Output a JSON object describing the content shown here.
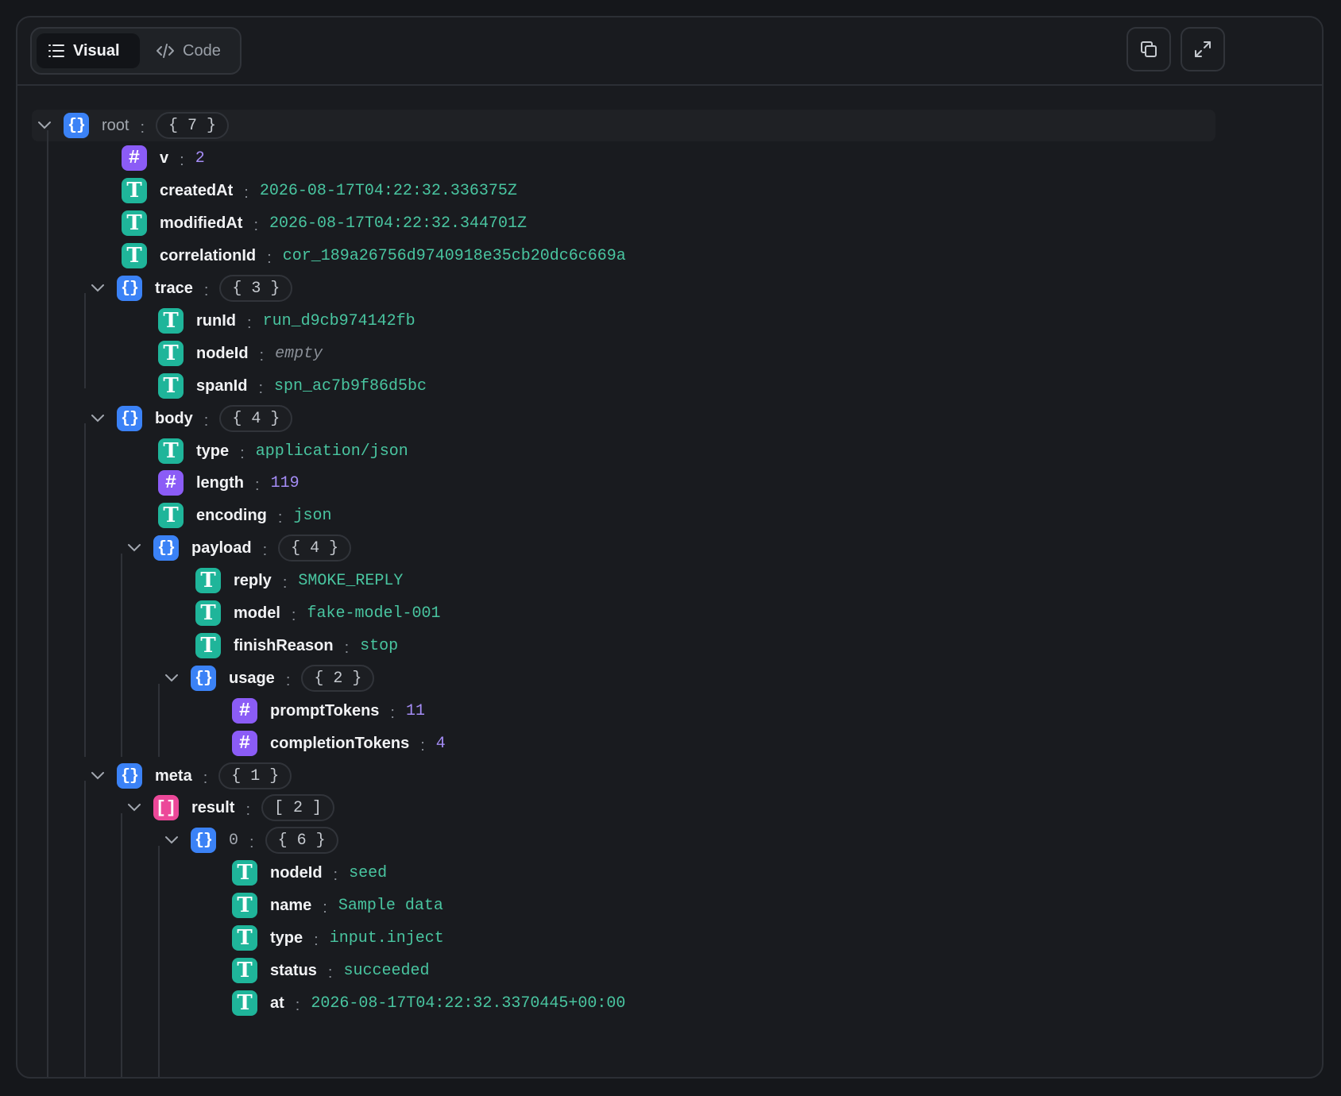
{
  "toolbar": {
    "tab_visual": "Visual",
    "tab_code": "Code",
    "active_tab": "Visual",
    "copy_icon": "copy-icon",
    "expand_icon": "expand-icon"
  },
  "colors": {
    "object_badge": "#3b82f6",
    "string_badge": "#1fb59a",
    "number_badge": "#8b5cf6",
    "array_badge": "#ec4899",
    "string_value": "#49c5a0",
    "number_value": "#a48cf5"
  },
  "tree": {
    "root": {
      "key": "root",
      "count": "{ 7 }"
    },
    "v": {
      "key": "v",
      "value": "2"
    },
    "createdAt": {
      "key": "createdAt",
      "value": "2026-08-17T04:22:32.336375Z"
    },
    "modifiedAt": {
      "key": "modifiedAt",
      "value": "2026-08-17T04:22:32.344701Z"
    },
    "correlationId": {
      "key": "correlationId",
      "value": "cor_189a26756d9740918e35cb20dc6c669a"
    },
    "trace": {
      "key": "trace",
      "count": "{ 3 }",
      "runId": {
        "key": "runId",
        "value": "run_d9cb974142fb"
      },
      "nodeId": {
        "key": "nodeId",
        "value": "empty"
      },
      "spanId": {
        "key": "spanId",
        "value": "spn_ac7b9f86d5bc"
      }
    },
    "body": {
      "key": "body",
      "count": "{ 4 }",
      "type": {
        "key": "type",
        "value": "application/json"
      },
      "length": {
        "key": "length",
        "value": "119"
      },
      "encoding": {
        "key": "encoding",
        "value": "json"
      },
      "payload": {
        "key": "payload",
        "count": "{ 4 }",
        "reply": {
          "key": "reply",
          "value": "SMOKE_REPLY"
        },
        "model": {
          "key": "model",
          "value": "fake-model-001"
        },
        "finishReason": {
          "key": "finishReason",
          "value": "stop"
        },
        "usage": {
          "key": "usage",
          "count": "{ 2 }",
          "promptTokens": {
            "key": "promptTokens",
            "value": "11"
          },
          "completionTokens": {
            "key": "completionTokens",
            "value": "4"
          }
        }
      }
    },
    "meta": {
      "key": "meta",
      "count": "{ 1 }",
      "result": {
        "key": "result",
        "count": "[ 2 ]",
        "item0": {
          "key": "0",
          "count": "{ 6 }",
          "nodeId": {
            "key": "nodeId",
            "value": "seed"
          },
          "name": {
            "key": "name",
            "value": "Sample data"
          },
          "type": {
            "key": "type",
            "value": "input.inject"
          },
          "status": {
            "key": "status",
            "value": "succeeded"
          },
          "at": {
            "key": "at",
            "value": "2026-08-17T04:22:32.3370445+00:00"
          }
        }
      }
    }
  }
}
